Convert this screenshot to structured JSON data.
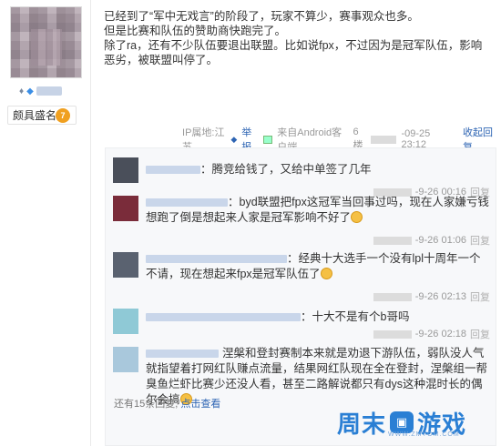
{
  "user": {
    "badge_label": "颇具盛名",
    "badge_level": "7"
  },
  "post": {
    "lines": [
      "已经到了“军中无戏言”的阶段了，玩家不算少，赛事观众也多。",
      "但是比赛和队伍的赞助商快跑完了。",
      "除了ra，还有不少队伍要退出联盟。比如说fpx，不过因为是冠军队伍，影响恶劣，被联盟叫停了。"
    ]
  },
  "meta": {
    "ip": "IP属地:江苏",
    "report": "举报",
    "source": "来自Android客户端",
    "floor": "6楼",
    "date": "-09-25 23:12",
    "collapse": "收起回复"
  },
  "replies": [
    {
      "text": "：腾竞给钱了，又给中单签了几年",
      "time": "-9-26 00:16",
      "reply": "回复",
      "avatar_color": "#4a4f5a"
    },
    {
      "text": "：byd联盟把fpx这冠军当回事过吗，现在人家嫌亏钱想跑了倒是想起来人家是冠军影响不好了",
      "time": "-9-26 01:06",
      "reply": "回复",
      "avatar_color": "#7a2c3a"
    },
    {
      "text": "：经典十大选手一个没有lpl十周年一个不请，现在想起来fpx是冠军队伍了",
      "time": "-9-26 02:13",
      "reply": "回复",
      "avatar_color": "#5a6270"
    },
    {
      "text": "：十大不是有个b哥吗",
      "time": "-9-26 02:18",
      "reply": "回复",
      "avatar_color": "#8fc9d6"
    },
    {
      "text": "涅槃和登封赛制本来就是劝退下游队伍，弱队没人气就指望着打网红队赚点流量，结果网红队现在全在登封，涅槃组一帮臭鱼烂虾比赛少还没人看，甚至二路解说都只有dys这种混时长的偶尔会搞",
      "time": "",
      "reply": "",
      "avatar_color": "#a9c8dc"
    }
  ],
  "footer": {
    "count": "还有15条回复,",
    "more": "点击查看"
  },
  "watermark": {
    "text1": "周末",
    "text2": "游戏",
    "sub": "WWW.ZMYOM.COM"
  },
  "colors": {
    "link": "#2d64b3",
    "watermark": "#2a7fd4"
  }
}
